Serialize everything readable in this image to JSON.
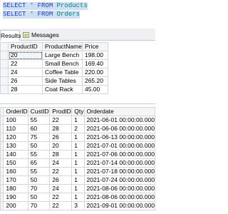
{
  "query": {
    "line1": {
      "select": "SELECT",
      "star": "*",
      "from": "FROM",
      "table": "Products"
    },
    "line2": {
      "select": "SELECT",
      "star": "*",
      "from": "FROM",
      "table": "Orders"
    }
  },
  "tabs": {
    "results": "Results",
    "messages": "Messages"
  },
  "products": {
    "columns": [
      "ProductID",
      "ProductName",
      "Price"
    ],
    "rows": [
      [
        "20",
        "Large Bench",
        "198.00"
      ],
      [
        "22",
        "Small Bench",
        "169.40"
      ],
      [
        "24",
        "Coffee Table",
        "220.00"
      ],
      [
        "26",
        "Side Tables",
        "265.20"
      ],
      [
        "28",
        "Coat Rack",
        "45.00"
      ]
    ]
  },
  "orders": {
    "columns": [
      "OrderID",
      "CustID",
      "ProdID",
      "Qty",
      "Orderdate"
    ],
    "rows": [
      [
        "100",
        "55",
        "22",
        "1",
        "2021-06-01 00:00:00.000"
      ],
      [
        "110",
        "60",
        "28",
        "2",
        "2021-06-06 00:00:00.000"
      ],
      [
        "120",
        "75",
        "26",
        "1",
        "2021-06-13 00:00:00.000"
      ],
      [
        "130",
        "50",
        "20",
        "1",
        "2021-07-01 00:00:00.000"
      ],
      [
        "140",
        "55",
        "28",
        "1",
        "2021-07-06 00:00:00.000"
      ],
      [
        "150",
        "65",
        "24",
        "1",
        "2021-07-14 00:00:00.000"
      ],
      [
        "160",
        "55",
        "22",
        "1",
        "2021-07-18 00:00:00.000"
      ],
      [
        "170",
        "50",
        "26",
        "1",
        "2021-07-24 00:00:00.000"
      ],
      [
        "180",
        "70",
        "24",
        "1",
        "2021-08-06 00:00:00.000"
      ],
      [
        "190",
        "50",
        "22",
        "1",
        "2021-08-06 00:00:00.000"
      ],
      [
        "200",
        "70",
        "22",
        "3",
        "2021-09-01 00:00:00.000"
      ]
    ]
  },
  "colors": {
    "keyword": "#1c3fd6",
    "table_name": "#008080",
    "selection": "#cfe0f4",
    "grid_line": "#d3d7dc",
    "header_bg": "#f4f5f7"
  }
}
